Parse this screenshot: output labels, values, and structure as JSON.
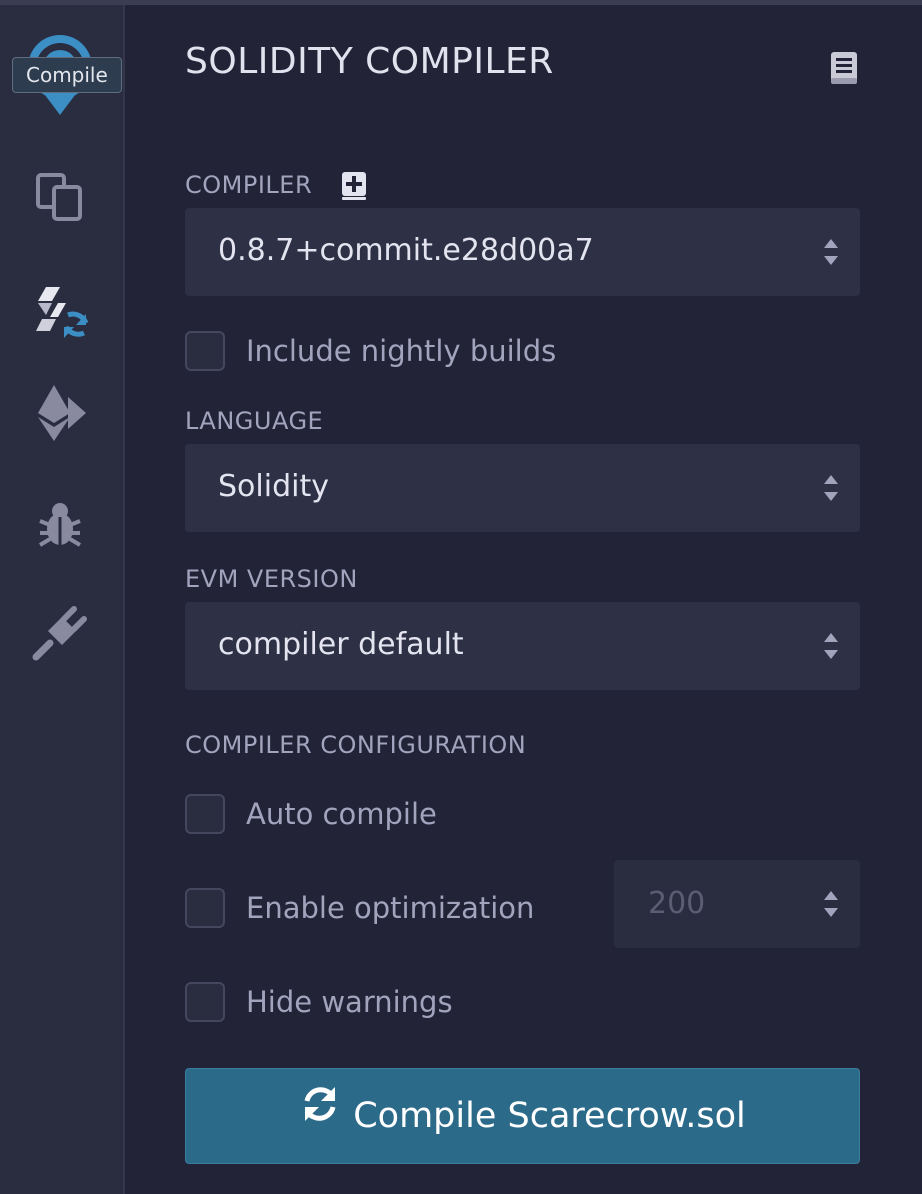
{
  "tooltip": "Compile",
  "sidebar": {
    "items": [
      {
        "name": "solidity-logo-icon"
      },
      {
        "name": "file-explorer-icon"
      },
      {
        "name": "solidity-compiler-icon"
      },
      {
        "name": "deploy-run-icon"
      },
      {
        "name": "debugger-icon"
      },
      {
        "name": "plugin-manager-icon"
      }
    ]
  },
  "panel": {
    "title": "SOLIDITY COMPILER",
    "compiler": {
      "label": "COMPILER",
      "value": "0.8.7+commit.e28d00a7"
    },
    "nightly": {
      "label": "Include nightly builds",
      "checked": false
    },
    "language": {
      "label": "LANGUAGE",
      "value": "Solidity"
    },
    "evm": {
      "label": "EVM VERSION",
      "value": "compiler default"
    },
    "config": {
      "label": "COMPILER CONFIGURATION",
      "auto_compile": {
        "label": "Auto compile",
        "checked": false
      },
      "optimization": {
        "label": "Enable optimization",
        "checked": false,
        "runs": "200"
      },
      "hide_warnings": {
        "label": "Hide warnings",
        "checked": false
      }
    },
    "compile_button": "Compile Scarecrow.sol"
  },
  "colors": {
    "accent": "#2c6a8a",
    "background": "#222336",
    "rail": "#2a2c3f",
    "logo": "#3c8fc4"
  }
}
